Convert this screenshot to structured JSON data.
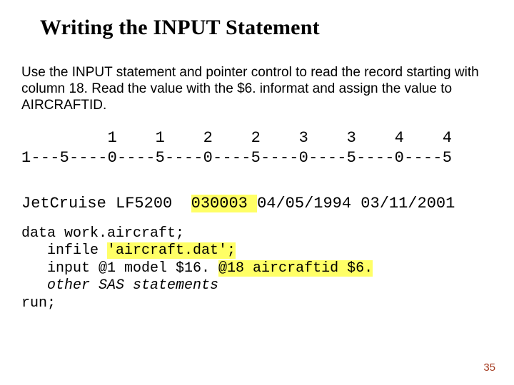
{
  "title": "Writing the INPUT Statement",
  "body": "Use the INPUT statement and pointer control to read the record starting with column 18.  Read the value with the $6. informat and assign the value to AIRCRAFTID.",
  "ruler": {
    "tens": "         1    1    2    2    3    3    4    4",
    "units": "1---5----0----5----0----5----0----5----0----5"
  },
  "data_row": {
    "model": "JetCruise LF5200",
    "gap": "  ",
    "aircraftid": "030003 ",
    "dates": "04/05/1994 03/11/2001"
  },
  "code": {
    "l1": "data work.aircraft;",
    "l2a": "   infile ",
    "l2b": "'aircraft.dat';",
    "l3a": "   input @1 model $16. ",
    "l3b": "@18 aircraftid $6.",
    "l4": "   other SAS statements",
    "l5": "run;"
  },
  "page": "35"
}
